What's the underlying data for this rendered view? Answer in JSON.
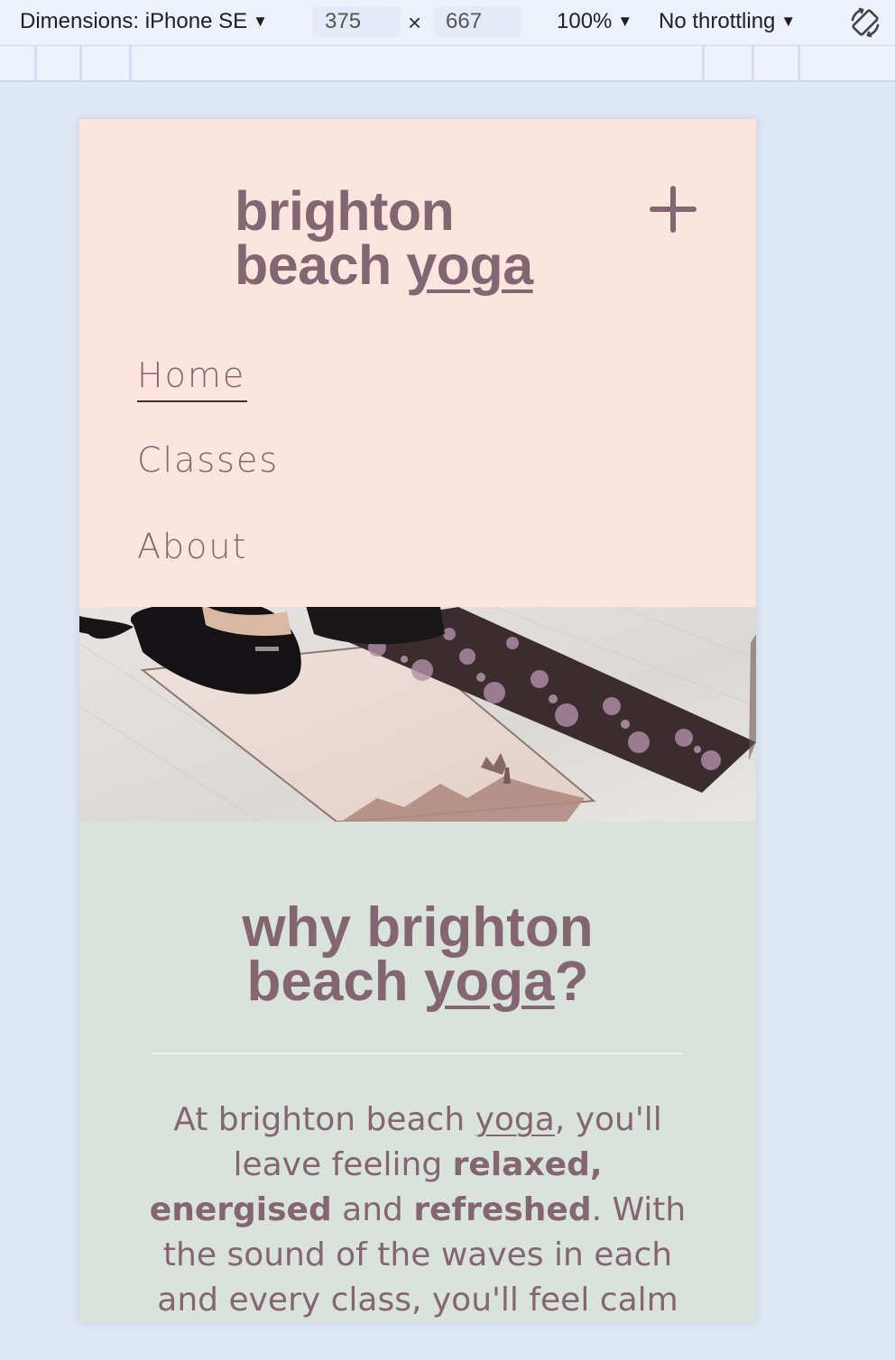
{
  "devtools": {
    "device_label": "Dimensions: iPhone SE",
    "width_value": "375",
    "height_value": "667",
    "times_symbol": "×",
    "zoom_label": "100%",
    "throttle_label": "No throttling"
  },
  "site": {
    "logo_line1": "brighton",
    "logo_line2_pre": "beach ",
    "logo_line2_u": "yoga",
    "nav": [
      "Home",
      "Classes",
      "About"
    ],
    "hero_alt": "Two people sitting on yoga mats on a wooden floor",
    "headline_line1": "why brighton",
    "headline_line2_pre": "beach ",
    "headline_line2_u": "yoga",
    "headline_line2_post": "?",
    "body": {
      "p1": "At brighton beach ",
      "p1_u": "yoga",
      "p2": ", you'll leave feeling ",
      "b1": "relaxed, energised",
      "p3": " and ",
      "b2": "refreshed",
      "p4": ". With the sound of the waves in each and every class, you'll feel calm"
    }
  },
  "colors": {
    "header_bg": "#fbe5dc",
    "content_bg": "#dae2dc",
    "brand_text": "#836671"
  },
  "icons": {
    "menu_toggle": "plus-icon",
    "rotate": "rotate-device-icon"
  }
}
